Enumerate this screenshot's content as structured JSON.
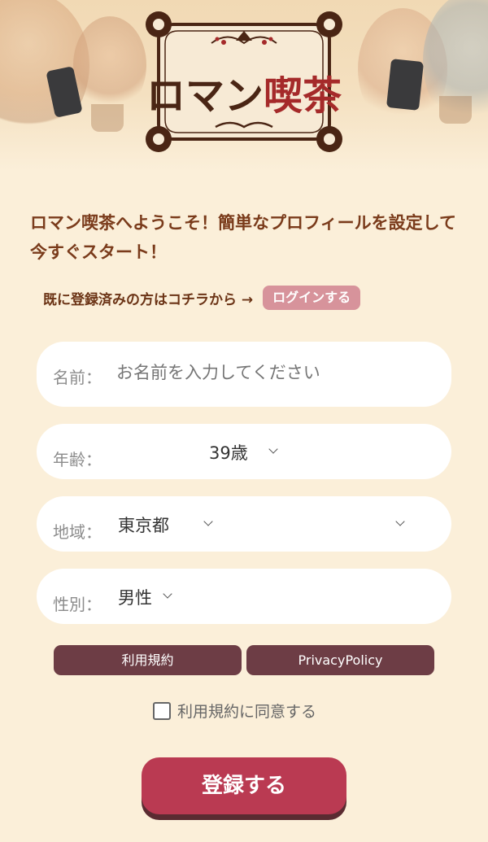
{
  "logo": {
    "name_main": "ロマン",
    "name_accent": "喫茶"
  },
  "welcome_text": "ロマン喫茶へようこそ！簡単なプロフィールを設定して今すぐスタート！",
  "login": {
    "prompt": "既に登録済みの方はコチラから →",
    "button_label": "ログインする"
  },
  "form": {
    "name": {
      "label": "名前：",
      "placeholder": "お名前を入力してください",
      "value": ""
    },
    "age": {
      "label": "年齢：",
      "value": "39歳"
    },
    "area": {
      "label": "地域：",
      "value": "東京都"
    },
    "gender": {
      "label": "性別：",
      "value": "男性"
    }
  },
  "terms_button": "利用規約",
  "privacy_button": "PrivacyPolicy",
  "agree_label": "利用規約に同意する",
  "agree_checked": false,
  "register_button": "登録する",
  "colors": {
    "background": "#fbefd9",
    "accent": "#ba3a52",
    "button_dark": "#6d3d45",
    "login_pill": "#d7939b",
    "welcome_text": "#7a3b1b"
  },
  "icons": [
    "chevron-down-icon",
    "checkbox-icon",
    "ornament-icon"
  ]
}
